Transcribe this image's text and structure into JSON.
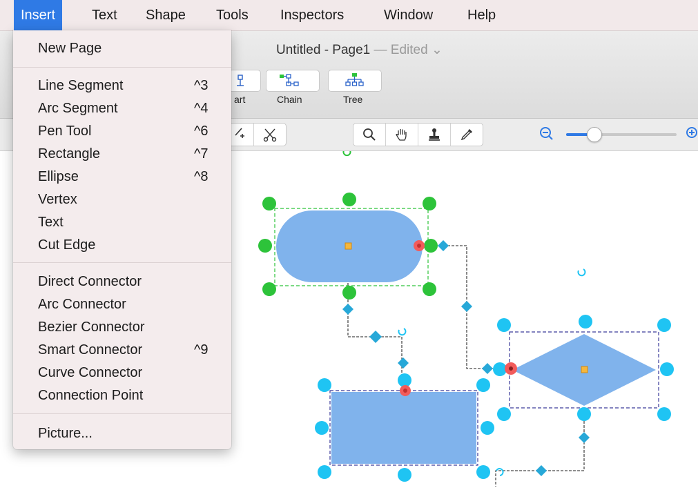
{
  "menubar": {
    "items": [
      "Insert",
      "Text",
      "Shape",
      "Tools",
      "Inspectors",
      "Window",
      "Help"
    ]
  },
  "window": {
    "title": "Untitled - Page1",
    "edited": "— Edited ⌄"
  },
  "toolbar": {
    "buttons": [
      {
        "label": "art"
      },
      {
        "label": "Chain"
      },
      {
        "label": "Tree"
      }
    ]
  },
  "zoom": {
    "level": 0.25
  },
  "insert_menu": {
    "items": [
      {
        "label": "New Page",
        "shortcut": ""
      },
      {
        "label": "Line Segment",
        "shortcut": "^3"
      },
      {
        "label": "Arc Segment",
        "shortcut": "^4"
      },
      {
        "label": "Pen Tool",
        "shortcut": "^6"
      },
      {
        "label": "Rectangle",
        "shortcut": "^7"
      },
      {
        "label": "Ellipse",
        "shortcut": "^8"
      },
      {
        "label": "Vertex",
        "shortcut": ""
      },
      {
        "label": "Text",
        "shortcut": ""
      },
      {
        "label": "Cut Edge",
        "shortcut": ""
      },
      {
        "label": "Direct Connector",
        "shortcut": ""
      },
      {
        "label": "Arc Connector",
        "shortcut": ""
      },
      {
        "label": "Bezier Connector",
        "shortcut": ""
      },
      {
        "label": "Smart Connector",
        "shortcut": "^9"
      },
      {
        "label": "Curve Connector",
        "shortcut": ""
      },
      {
        "label": "Connection Point",
        "shortcut": ""
      },
      {
        "label": "Picture...",
        "shortcut": ""
      }
    ]
  },
  "colors": {
    "accent": "#2f7ae5",
    "shape_fill": "#80b3ec",
    "handle_green": "#2dc33a",
    "handle_cyan": "#1fc4f3",
    "connector": "#4a4a4a",
    "diamond_handle": "#27a8d8",
    "connection_red": "#f25b5b",
    "center_handle": "#f6b73c"
  }
}
